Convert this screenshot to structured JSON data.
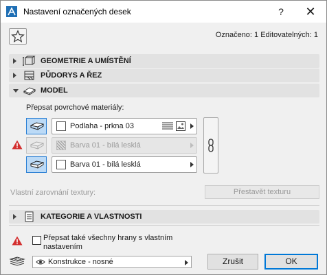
{
  "window": {
    "title": "Nastavení označených desek",
    "help_label": "?",
    "close_label": "✕"
  },
  "header": {
    "selected_info": "Označeno: 1 Editovatelných: 1"
  },
  "sections": {
    "geometry": "GEOMETRIE A UMÍSTĚNÍ",
    "floorplan": "PŮDORYS A ŘEZ",
    "model": "MODEL",
    "category": "KATEGORIE A VLASTNOSTI"
  },
  "model": {
    "override_label": "Přepsat povrchové materiály:",
    "materials": [
      {
        "name": "Podlaha - prkna 03",
        "enabled": true
      },
      {
        "name": "Barva 01 - bílá lesklá",
        "enabled": false
      },
      {
        "name": "Barva 01 - bílá lesklá",
        "enabled": true
      }
    ],
    "texture_label": "Vlastní zarovnání textury:",
    "rebuild_label": "Přestavět texturu"
  },
  "footer": {
    "edges_label": "Přepsat také všechny hrany s vlastním nastavením",
    "layer_value": "Konstrukce - nosné",
    "cancel_label": "Zrušit",
    "ok_label": "OK"
  },
  "colors": {
    "accent": "#0078d7",
    "selected_swatch": "#bcdaf6",
    "warning": "#d32f2f"
  }
}
